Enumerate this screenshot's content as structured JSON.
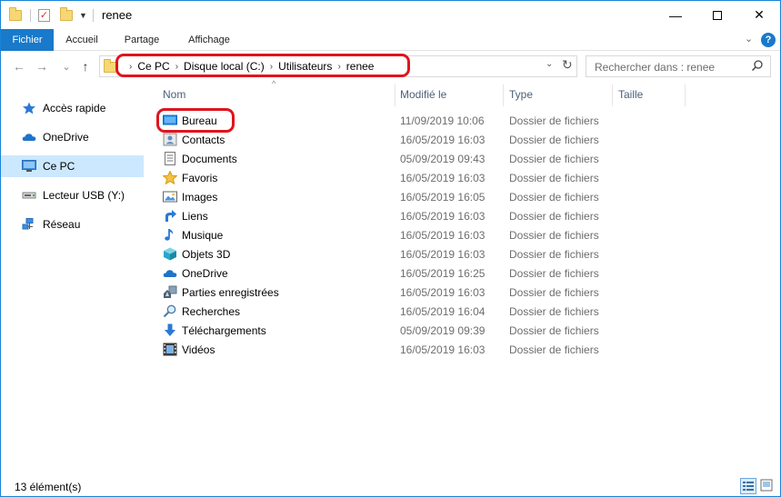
{
  "window": {
    "title": "renee",
    "controls": {
      "minimize": "—",
      "close": "✕"
    }
  },
  "ribbon": {
    "tabs": [
      "Fichier",
      "Accueil",
      "Partage",
      "Affichage"
    ],
    "collapse_glyph": "⌄",
    "help_glyph": "?"
  },
  "address": {
    "back_glyph": "←",
    "forward_glyph": "→",
    "recent_glyph": "⌄",
    "up_glyph": "↑",
    "crumbs": [
      "Ce PC",
      "Disque local (C:)",
      "Utilisateurs",
      "renee"
    ],
    "crumb_separator": "›",
    "dropdown_glyph": "⌄",
    "refresh_glyph": "↻"
  },
  "search": {
    "placeholder": "Rechercher dans : renee"
  },
  "nav": {
    "items": [
      {
        "label": "Accès rapide",
        "icon": "star-icon"
      },
      {
        "label": "OneDrive",
        "icon": "cloud-icon"
      },
      {
        "label": "Ce PC",
        "icon": "monitor-icon",
        "selected": true
      },
      {
        "label": "Lecteur USB (Y:)",
        "icon": "usb-drive-icon"
      },
      {
        "label": "Réseau",
        "icon": "network-icon"
      }
    ]
  },
  "columns": {
    "name": "Nom",
    "modified": "Modifié le",
    "type": "Type",
    "size": "Taille",
    "sort_glyph": "^"
  },
  "files": [
    {
      "name": "Bureau",
      "modified": "11/09/2019 10:06",
      "type": "Dossier de fichiers",
      "icon": "desktop-folder-icon"
    },
    {
      "name": "Contacts",
      "modified": "16/05/2019 16:03",
      "type": "Dossier de fichiers",
      "icon": "contacts-folder-icon"
    },
    {
      "name": "Documents",
      "modified": "05/09/2019 09:43",
      "type": "Dossier de fichiers",
      "icon": "documents-folder-icon"
    },
    {
      "name": "Favoris",
      "modified": "16/05/2019 16:03",
      "type": "Dossier de fichiers",
      "icon": "favorites-star-icon"
    },
    {
      "name": "Images",
      "modified": "16/05/2019 16:05",
      "type": "Dossier de fichiers",
      "icon": "images-folder-icon"
    },
    {
      "name": "Liens",
      "modified": "16/05/2019 16:03",
      "type": "Dossier de fichiers",
      "icon": "links-arrow-icon"
    },
    {
      "name": "Musique",
      "modified": "16/05/2019 16:03",
      "type": "Dossier de fichiers",
      "icon": "music-note-icon"
    },
    {
      "name": "Objets 3D",
      "modified": "16/05/2019 16:03",
      "type": "Dossier de fichiers",
      "icon": "cube-3d-icon"
    },
    {
      "name": "OneDrive",
      "modified": "16/05/2019 16:25",
      "type": "Dossier de fichiers",
      "icon": "cloud-icon"
    },
    {
      "name": "Parties enregistrées",
      "modified": "16/05/2019 16:03",
      "type": "Dossier de fichiers",
      "icon": "saved-games-icon"
    },
    {
      "name": "Recherches",
      "modified": "16/05/2019 16:04",
      "type": "Dossier de fichiers",
      "icon": "search-icon"
    },
    {
      "name": "Téléchargements",
      "modified": "05/09/2019 09:39",
      "type": "Dossier de fichiers",
      "icon": "download-arrow-icon"
    },
    {
      "name": "Vidéos",
      "modified": "16/05/2019 16:03",
      "type": "Dossier de fichiers",
      "icon": "video-film-icon"
    }
  ],
  "status": {
    "count": "13 élément(s)"
  },
  "colors": {
    "accent": "#1979ca",
    "highlight": "#e0141e",
    "selection": "#cce8ff",
    "header_text": "#4d6078",
    "secondary_text": "#6d6d6d"
  }
}
